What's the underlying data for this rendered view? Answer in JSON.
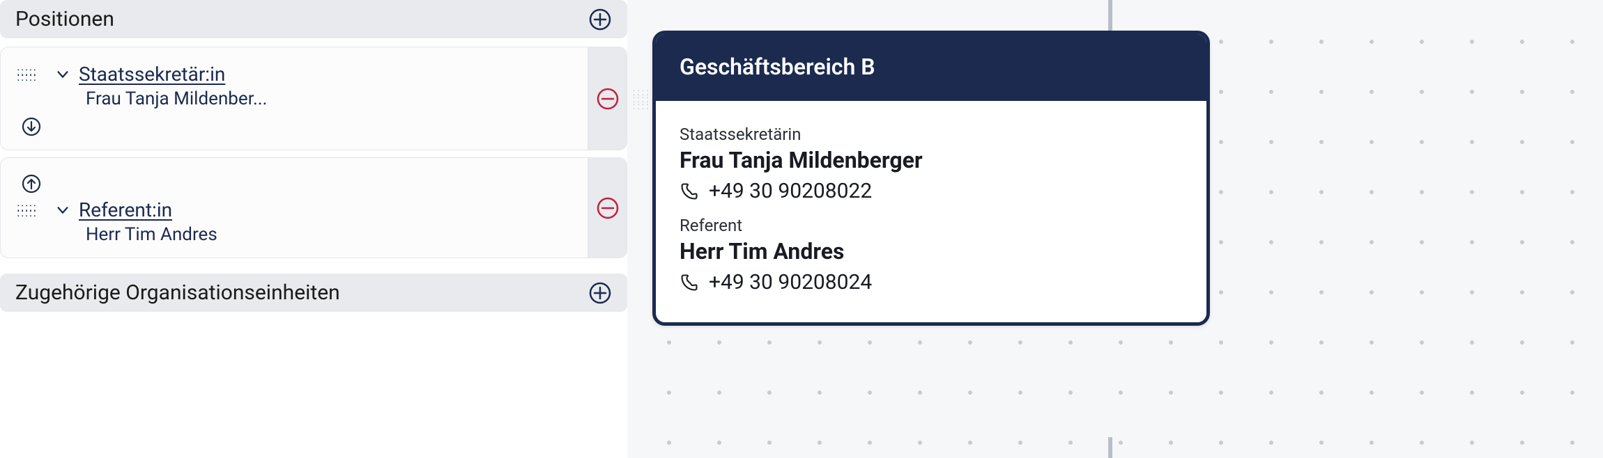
{
  "sections": {
    "positions": {
      "title": "Positionen",
      "items": [
        {
          "title": "Staatssekretär:in",
          "subtitle": "Frau Tanja Mildenber..."
        },
        {
          "title": "Referent:in",
          "subtitle": "Herr Tim Andres"
        }
      ]
    },
    "orgunits": {
      "title": "Zugehörige Organisationseinheiten"
    }
  },
  "org_card": {
    "header": "Geschäftsbereich B",
    "roles": [
      {
        "label": "Staatssekretärin",
        "name": "Frau Tanja Mildenberger",
        "phone": "+49 30 90208022"
      },
      {
        "label": "Referent",
        "name": "Herr Tim Andres",
        "phone": "+49 30 90208024"
      }
    ]
  },
  "colors": {
    "brand": "#1b2a4e",
    "danger": "#c2203f"
  }
}
